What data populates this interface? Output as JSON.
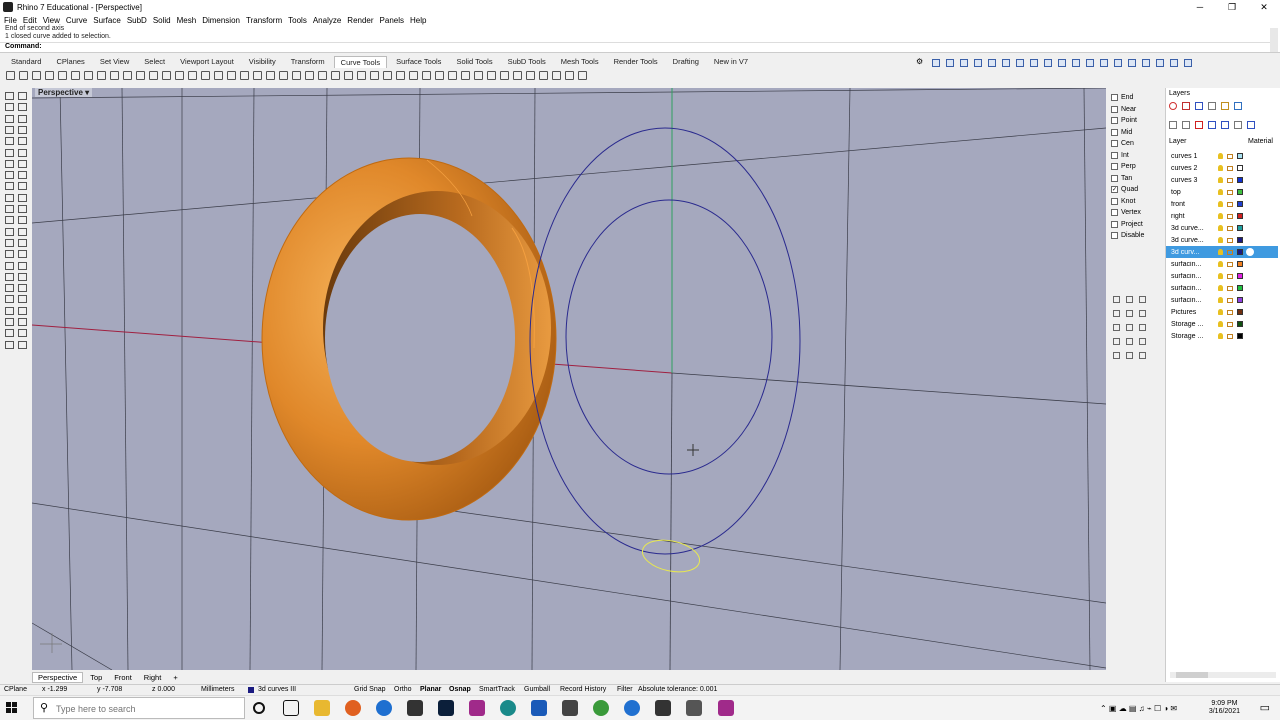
{
  "window": {
    "title": "Rhino 7 Educational - [Perspective]",
    "min": "─",
    "max": "❐",
    "close": "✕"
  },
  "menu": [
    "File",
    "Edit",
    "View",
    "Curve",
    "Surface",
    "SubD",
    "Solid",
    "Mesh",
    "Dimension",
    "Transform",
    "Tools",
    "Analyze",
    "Render",
    "Panels",
    "Help"
  ],
  "command": {
    "history": [
      "End of second axis",
      "1 closed curve added to selection."
    ],
    "label": "Command:",
    "value": ""
  },
  "toolbar_tabs": [
    "Standard",
    "CPlanes",
    "Set View",
    "Select",
    "Viewport Layout",
    "Visibility",
    "Transform",
    "Curve Tools",
    "Surface Tools",
    "Solid Tools",
    "SubD Tools",
    "Mesh Tools",
    "Render Tools",
    "Drafting",
    "New in V7"
  ],
  "active_toolbar_tab": "Curve Tools",
  "viewport": {
    "title": "Perspective",
    "dropdown_icon": "▾"
  },
  "osnap": [
    {
      "label": "End",
      "checked": false
    },
    {
      "label": "Near",
      "checked": false
    },
    {
      "label": "Point",
      "checked": false
    },
    {
      "label": "Mid",
      "checked": false
    },
    {
      "label": "Cen",
      "checked": false
    },
    {
      "label": "Int",
      "checked": false
    },
    {
      "label": "Perp",
      "checked": false
    },
    {
      "label": "Tan",
      "checked": false
    },
    {
      "label": "Quad",
      "checked": true
    },
    {
      "label": "Knot",
      "checked": false
    },
    {
      "label": "Vertex",
      "checked": false
    },
    {
      "label": "Project",
      "checked": false
    },
    {
      "label": "Disable",
      "checked": false
    }
  ],
  "layers": {
    "panel_title": "Layers",
    "col_layer": "Layer",
    "col_material": "Material",
    "rows": [
      {
        "name": "curves 1",
        "color": "#a8e0f0",
        "selected": false
      },
      {
        "name": "curves 2",
        "color": "#ffffff",
        "selected": false
      },
      {
        "name": "curves 3",
        "color": "#1030d0",
        "selected": false
      },
      {
        "name": "top",
        "color": "#40c040",
        "selected": false
      },
      {
        "name": "front",
        "color": "#2040d0",
        "selected": false
      },
      {
        "name": "right",
        "color": "#d02020",
        "selected": false
      },
      {
        "name": "3d curve...",
        "color": "#20a0a0",
        "selected": false
      },
      {
        "name": "3d curve...",
        "color": "#1a1a80",
        "selected": false
      },
      {
        "name": "3d curv...",
        "color": "#1a1a80",
        "selected": true
      },
      {
        "name": "surfacin...",
        "color": "#f08020",
        "selected": false
      },
      {
        "name": "surfacin...",
        "color": "#e020e0",
        "selected": false
      },
      {
        "name": "surfacin...",
        "color": "#20c040",
        "selected": false
      },
      {
        "name": "surfacin...",
        "color": "#9040e0",
        "selected": false
      },
      {
        "name": "Pictures",
        "color": "#703010",
        "selected": false
      },
      {
        "name": "Storage ...",
        "color": "#105010",
        "selected": false
      },
      {
        "name": "Storage ...",
        "color": "#000000",
        "selected": false
      }
    ]
  },
  "viewport_tabs": [
    "Perspective",
    "Top",
    "Front",
    "Right",
    "+"
  ],
  "active_viewport_tab": "Perspective",
  "status": {
    "cplane": "CPlane",
    "x": "x -1.299",
    "y": "y -7.708",
    "z": "z 0.000",
    "units": "Millimeters",
    "layer": "3d curves III",
    "grid_snap": "Grid Snap",
    "ortho": "Ortho",
    "planar": "Planar",
    "osnap": "Osnap",
    "smarttrack": "SmartTrack",
    "gumball": "Gumball",
    "record_history": "Record History",
    "filter": "Filter",
    "tolerance": "Absolute tolerance: 0.001"
  },
  "taskbar": {
    "search_placeholder": "Type here to search",
    "time": "9:09 PM",
    "date": "3/16/2021"
  },
  "colors": {
    "viewport_bg": "#a5a8be",
    "ring_orange": "#e08a2a",
    "curve_blue": "#2a2a8e",
    "x_axis": "#a02040",
    "y_axis": "#30a060",
    "selection_blue": "#3f9ae0"
  }
}
